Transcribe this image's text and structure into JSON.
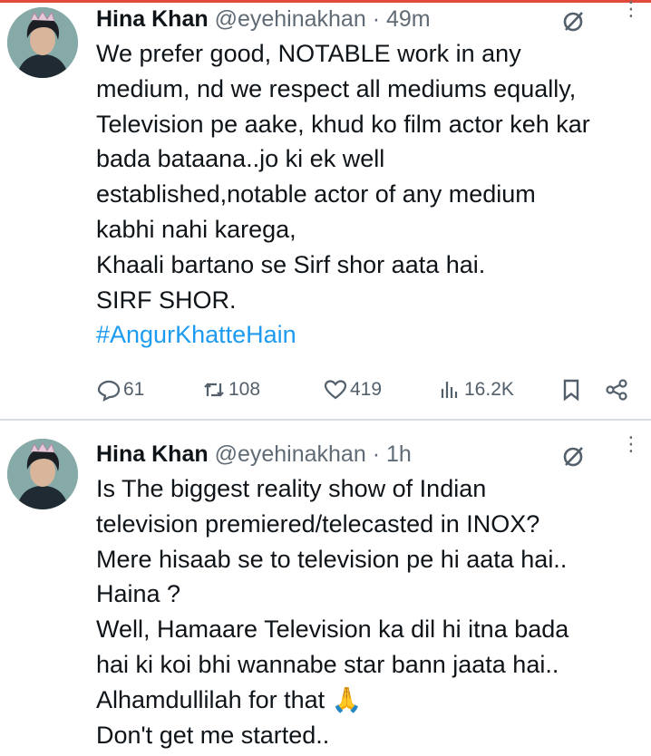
{
  "tweets": [
    {
      "name": "Hina Khan",
      "handle": "@eyehinakhan",
      "separator": "·",
      "time": "49m",
      "lines": [
        "We prefer good, NOTABLE work in any",
        "medium, nd we respect all mediums equally,",
        "Television pe aake, khud ko film actor keh kar",
        "bada bataana..jo ki ek well",
        "established,notable actor of any medium",
        "kabhi nahi karega,",
        "Khaali bartano se Sirf shor aata hai.",
        "SIRF SHOR."
      ],
      "hashtag": "#AngurKhatteHain",
      "stats": {
        "replies": "61",
        "reposts": "108",
        "likes": "419",
        "views": "16.2K"
      }
    },
    {
      "name": "Hina Khan",
      "handle": "@eyehinakhan",
      "separator": "·",
      "time": "1h",
      "lines": [
        "Is The biggest reality show of Indian",
        "television premiered/telecasted in INOX?",
        "Mere hisaab se to television pe hi aata hai..",
        "Haina ?",
        "Well, Hamaare Television ka dil hi itna bada",
        "hai ki koi bhi wannabe star bann jaata hai..",
        "Alhamdullilah for that 🙏",
        "Don't get me started.."
      ]
    }
  ],
  "colors": {
    "text": "#0f1419",
    "secondary": "#606b75",
    "link": "#1d9bf0",
    "avatar_bg": "#86aaa7"
  }
}
